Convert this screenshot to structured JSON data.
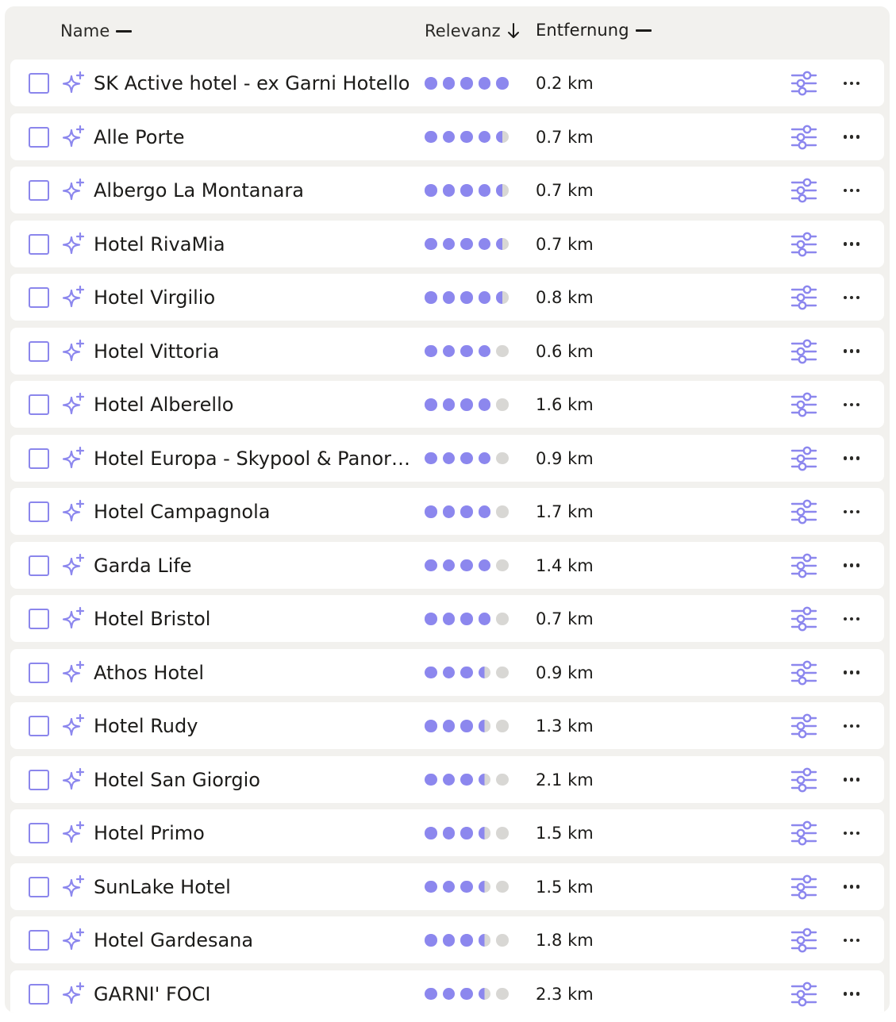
{
  "header": {
    "name_label": "Name",
    "relevance_label": "Relevanz",
    "distance_label": "Entfernung"
  },
  "colors": {
    "accent": "#8c87ee",
    "dot_empty": "#d8d7d4",
    "panel_bg": "#f2f1ee",
    "row_bg": "#ffffff"
  },
  "icons": {
    "sort_name": "dash-icon",
    "sort_relevance": "arrow-down-icon",
    "sort_distance": "dash-icon",
    "row_ai": "sparkle-icon",
    "row_adjust": "sliders-icon",
    "row_more": "more-horizontal-icon"
  },
  "hotels": [
    {
      "name": "SK Active hotel - ex Garni Hotello",
      "relevance": 5,
      "distance": "0.2 km"
    },
    {
      "name": "Alle Porte",
      "relevance": 4.5,
      "distance": "0.7 km"
    },
    {
      "name": "Albergo La Montanara",
      "relevance": 4.5,
      "distance": "0.7 km"
    },
    {
      "name": "Hotel RivaMia",
      "relevance": 4.5,
      "distance": "0.7 km"
    },
    {
      "name": "Hotel Virgilio",
      "relevance": 4.5,
      "distance": "0.8 km"
    },
    {
      "name": "Hotel Vittoria",
      "relevance": 4,
      "distance": "0.6 km"
    },
    {
      "name": "Hotel Alberello",
      "relevance": 4,
      "distance": "1.6 km"
    },
    {
      "name": "Hotel Europa - Skypool & Panorama",
      "relevance": 4,
      "distance": "0.9 km"
    },
    {
      "name": "Hotel Campagnola",
      "relevance": 4,
      "distance": "1.7 km"
    },
    {
      "name": "Garda Life",
      "relevance": 4,
      "distance": "1.4 km"
    },
    {
      "name": "Hotel Bristol",
      "relevance": 4,
      "distance": "0.7 km"
    },
    {
      "name": "Athos Hotel",
      "relevance": 3.5,
      "distance": "0.9 km"
    },
    {
      "name": "Hotel Rudy",
      "relevance": 3.5,
      "distance": "1.3 km"
    },
    {
      "name": "Hotel San Giorgio",
      "relevance": 3.5,
      "distance": "2.1 km"
    },
    {
      "name": "Hotel Primo",
      "relevance": 3.5,
      "distance": "1.5 km"
    },
    {
      "name": "SunLake Hotel",
      "relevance": 3.5,
      "distance": "1.5 km"
    },
    {
      "name": "Hotel Gardesana",
      "relevance": 3.5,
      "distance": "1.8 km"
    },
    {
      "name": "GARNI' FOCI",
      "relevance": 3.5,
      "distance": "2.3 km"
    }
  ]
}
